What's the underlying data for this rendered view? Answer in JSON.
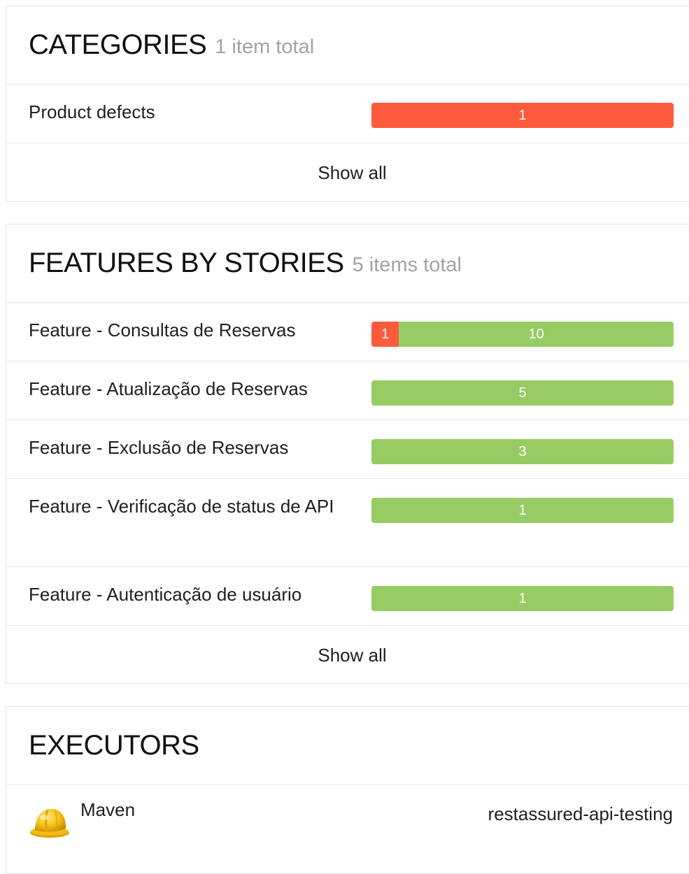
{
  "colors": {
    "failed": "#fd5a3e",
    "passed": "#97cc64",
    "subtitle": "#a3a3a3"
  },
  "categories": {
    "title": "CATEGORIES",
    "subtitle": "1 item total",
    "items": [
      {
        "label": "Product defects",
        "failed": 1,
        "passed": 0
      }
    ],
    "show_all": "Show all"
  },
  "features": {
    "title": "FEATURES BY STORIES",
    "subtitle": "5 items total",
    "items": [
      {
        "label": "Feature - Consultas de Reservas",
        "failed": 1,
        "passed": 10
      },
      {
        "label": "Feature - Atualização de Reservas",
        "failed": 0,
        "passed": 5
      },
      {
        "label": "Feature - Exclusão de Reservas",
        "failed": 0,
        "passed": 3
      },
      {
        "label": "Feature - Verificação de status de API",
        "failed": 0,
        "passed": 1
      },
      {
        "label": "Feature - Autenticação de usuário",
        "failed": 0,
        "passed": 1
      }
    ],
    "show_all": "Show all"
  },
  "executors": {
    "title": "EXECUTORS",
    "items": [
      {
        "name": "Maven",
        "build": "restassured-api-testing",
        "icon": "maven-hardhat-icon"
      }
    ]
  }
}
